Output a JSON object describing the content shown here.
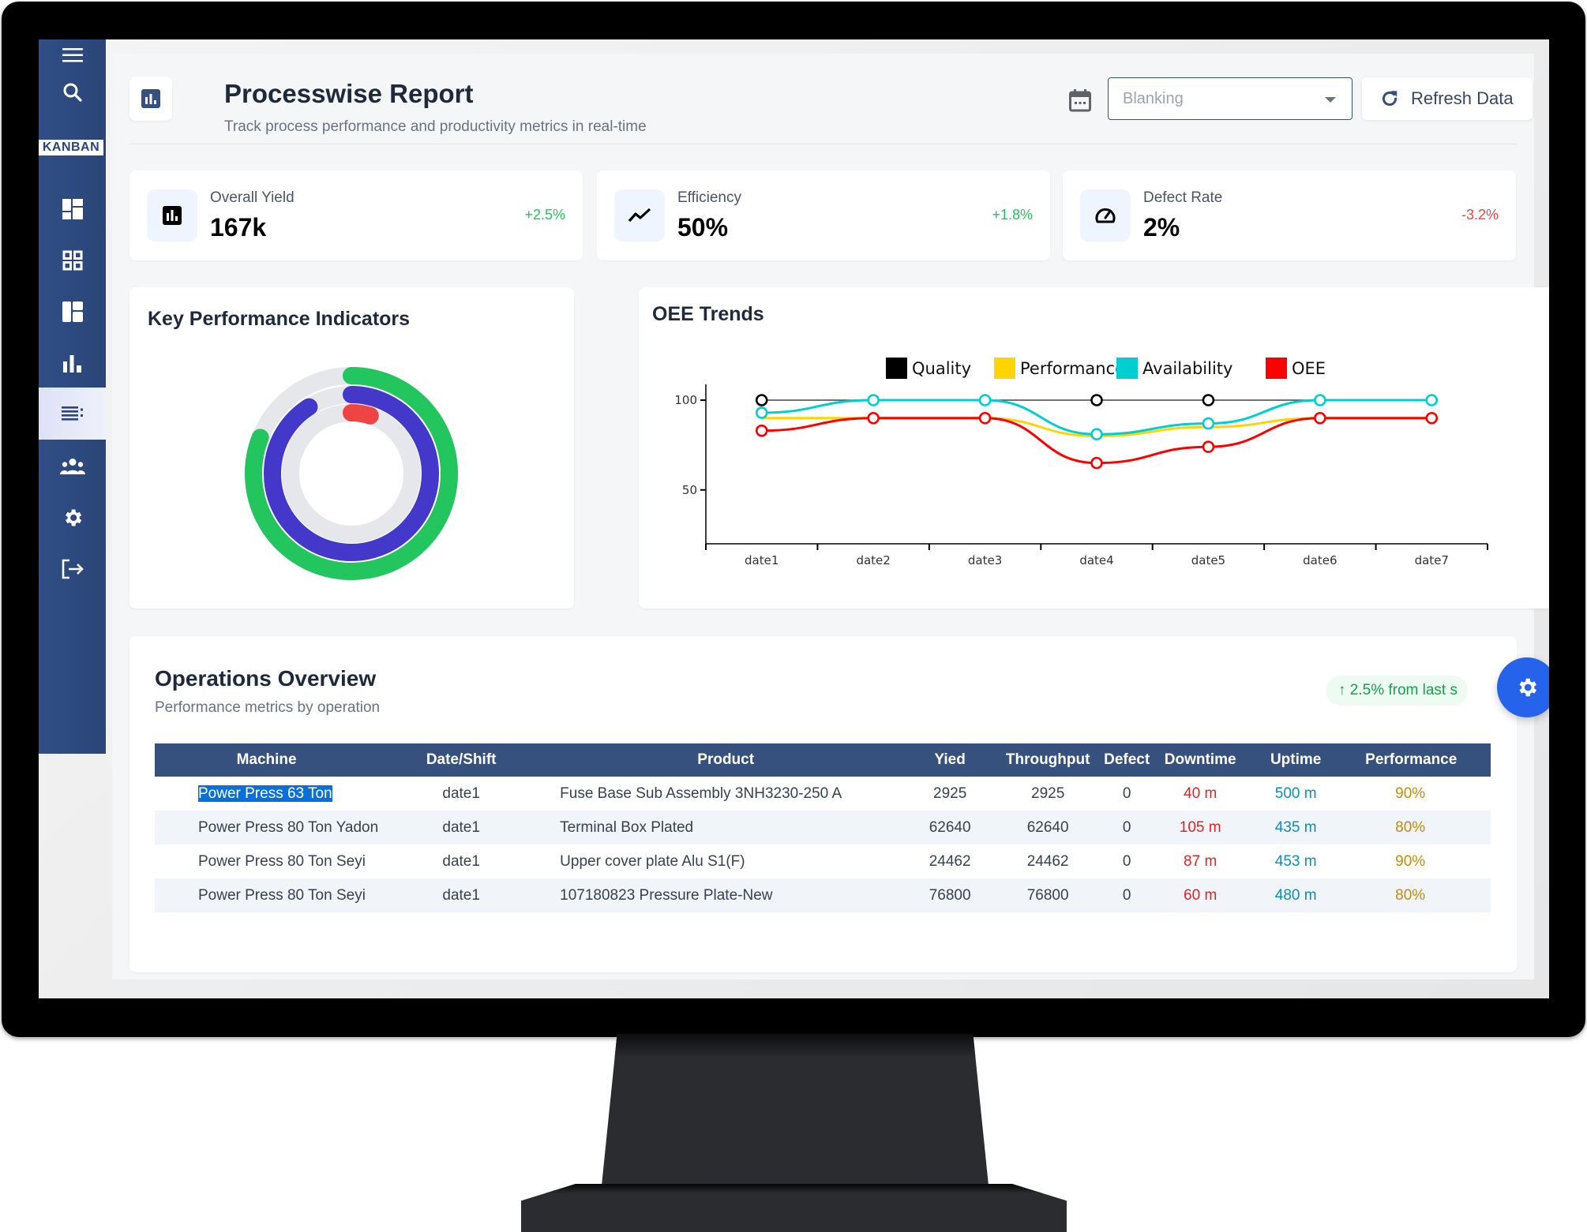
{
  "sidebar": {
    "brand": "KANBAN",
    "items": [
      {
        "icon": "menu-icon"
      },
      {
        "icon": "search-icon"
      },
      {
        "icon": "dashboard-icon"
      },
      {
        "icon": "grid-icon"
      },
      {
        "icon": "layout-icon"
      },
      {
        "icon": "bar-chart-icon"
      },
      {
        "icon": "list-icon",
        "active": true
      },
      {
        "icon": "people-icon"
      },
      {
        "icon": "gear-icon"
      },
      {
        "icon": "logout-icon"
      }
    ]
  },
  "header": {
    "title": "Processwise Report",
    "subtitle": "Track process performance and productivity metrics in real-time",
    "process_select": {
      "placeholder": "Blanking"
    },
    "refresh_label": "Refresh Data"
  },
  "stats": [
    {
      "label": "Overall Yield",
      "value": "167k",
      "delta": "+2.5%",
      "delta_color": "#22c55e",
      "icon": "bar-chart-icon"
    },
    {
      "label": "Efficiency",
      "value": "50%",
      "delta": "+1.8%",
      "delta_color": "#22c55e",
      "icon": "trend-icon"
    },
    {
      "label": "Defect Rate",
      "value": "2%",
      "delta": "-3.2%",
      "delta_color": "#ef4444",
      "icon": "gauge-icon"
    }
  ],
  "kpi_panel": {
    "title": "Key Performance Indicators"
  },
  "oee_panel": {
    "title": "OEE Trends"
  },
  "chart_data": [
    {
      "type": "radial-bar",
      "title": "Key Performance Indicators",
      "series": [
        {
          "name": "outer",
          "value": 0.81,
          "color": "#22c55e"
        },
        {
          "name": "middle",
          "value": 0.91,
          "color": "#4338ca"
        },
        {
          "name": "inner",
          "value": 0.05,
          "color": "#ef4444"
        }
      ],
      "track_color": "#e5e7eb"
    },
    {
      "type": "line",
      "title": "OEE Trends",
      "categories": [
        "date1",
        "date2",
        "date3",
        "date4",
        "date5",
        "date6",
        "date7"
      ],
      "series": [
        {
          "name": "Quality",
          "color": "#000000",
          "values": [
            100,
            100,
            100,
            100,
            100,
            100,
            100
          ]
        },
        {
          "name": "Performance",
          "color": "#ffd400",
          "values": [
            90,
            90,
            90,
            80,
            85,
            90,
            90
          ]
        },
        {
          "name": "Availability",
          "color": "#00ced1",
          "values": [
            93,
            100,
            100,
            81,
            87,
            100,
            100
          ]
        },
        {
          "name": "OEE",
          "color": "#ff0000",
          "values": [
            83,
            90,
            90,
            65,
            74,
            90,
            90
          ]
        }
      ],
      "yticks": [
        50,
        100
      ],
      "ylim": [
        20,
        100
      ],
      "legend": "top-center",
      "grid": false
    }
  ],
  "operations": {
    "title": "Operations Overview",
    "subtitle": "Performance metrics by operation",
    "badge": "↑ 2.5% from last s",
    "columns": [
      "Machine",
      "Date/Shift",
      "Product",
      "Yied",
      "Throughput",
      "Defect",
      "Downtime",
      "Uptime",
      "Performance"
    ],
    "rows": [
      [
        "Power Press 63 Ton",
        "date1",
        "Fuse Base Sub Assembly 3NH3230-250 A",
        "2925",
        "2925",
        "0",
        "40 m",
        "500 m",
        "90%"
      ],
      [
        "Power Press 80 Ton Yadon",
        "date1",
        "Terminal Box Plated",
        "62640",
        "62640",
        "0",
        "105 m",
        "435 m",
        "80%"
      ],
      [
        "Power Press 80 Ton Seyi",
        "date1",
        "Upper cover plate Alu S1(F)",
        "24462",
        "24462",
        "0",
        "87 m",
        "453 m",
        "90%"
      ],
      [
        "Power Press 80 Ton Seyi",
        "date1",
        "107180823 Pressure Plate-New",
        "76800",
        "76800",
        "0",
        "60 m",
        "480 m",
        "80%"
      ]
    ]
  }
}
